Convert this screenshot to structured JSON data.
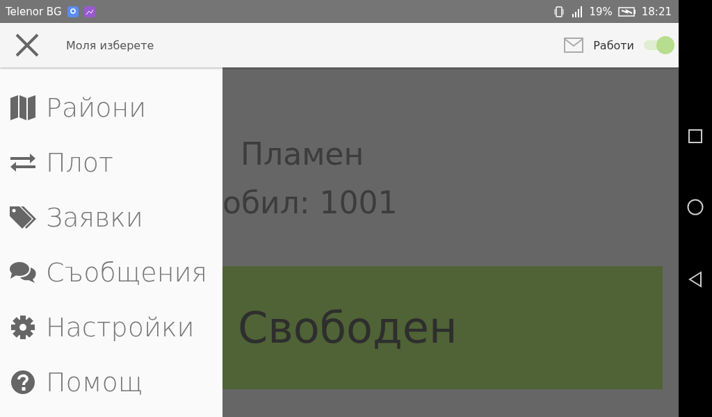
{
  "status_bar": {
    "carrier": "Telenor BG",
    "battery": "19%",
    "time": "18:21"
  },
  "app_bar": {
    "title": "Моля изберете",
    "work_label": "Работи",
    "work_toggle": {
      "on": true
    }
  },
  "drawer": {
    "items": [
      {
        "label": "Райони"
      },
      {
        "label": "Плот"
      },
      {
        "label": "Заявки"
      },
      {
        "label": "Съобщения"
      },
      {
        "label": "Настройки"
      },
      {
        "label": "Помощ"
      }
    ]
  },
  "main": {
    "lines": [
      "Пламен",
      "обил: 1001"
    ],
    "status_label": "Свободен"
  }
}
